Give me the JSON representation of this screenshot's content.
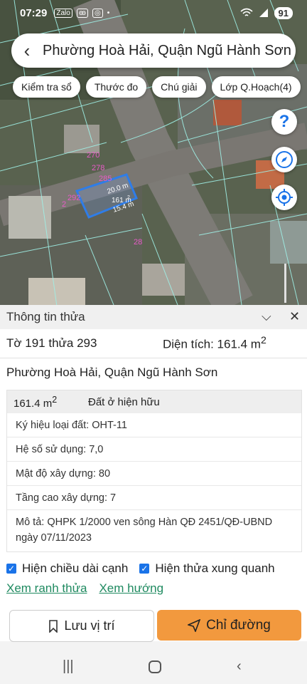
{
  "status": {
    "time": "07:29",
    "battery": "91",
    "notif_icons": [
      "Zalo",
      "ꙭ",
      "◎"
    ]
  },
  "header": {
    "back": "‹",
    "title": "Phường Hoà Hải, Quận Ngũ Hành Sơn"
  },
  "chips": [
    "Kiểm tra sổ",
    "Thước đo",
    "Chú giải",
    "Lớp Q.Hoạch(4)"
  ],
  "map": {
    "labels": {
      "p270": "270",
      "p278": "278",
      "p285": "285",
      "p292": "292",
      "p2": "2",
      "p28": "28",
      "len1": "20.0 m",
      "len2": "161 m",
      "len3": "15.4 m",
      "area_sup": "2"
    },
    "fab_help": "?"
  },
  "panel": {
    "title": "Thông tin thửa",
    "sheet": "Tờ 191 thửa 293",
    "area_label": "Diện tích: 161.4 m",
    "area_sup": "2",
    "address": "Phường Hoà Hải, Quận Ngũ Hành Sơn",
    "box_area": "161.4 m",
    "box_area_sup": "2",
    "land_type": "Đất ở hiện hữu",
    "lines": [
      "Ký hiệu loại đất: OHT-11",
      "Hệ số sử dụng: 7,0",
      "Mật độ xây dựng: 80",
      "Tầng cao xây dựng: 7"
    ],
    "desc": "Mô tả: QHPK 1/2000 ven sông Hàn QĐ 2451/QĐ-UBND ngày 07/11/2023",
    "check1": "Hiện chiều dài cạnh",
    "check2": "Hiện thửa xung quanh",
    "link1": "Xem ranh thửa",
    "link2": "Xem hướng"
  },
  "buttons": {
    "save": "Lưu vị trí",
    "directions": "Chỉ đường"
  }
}
